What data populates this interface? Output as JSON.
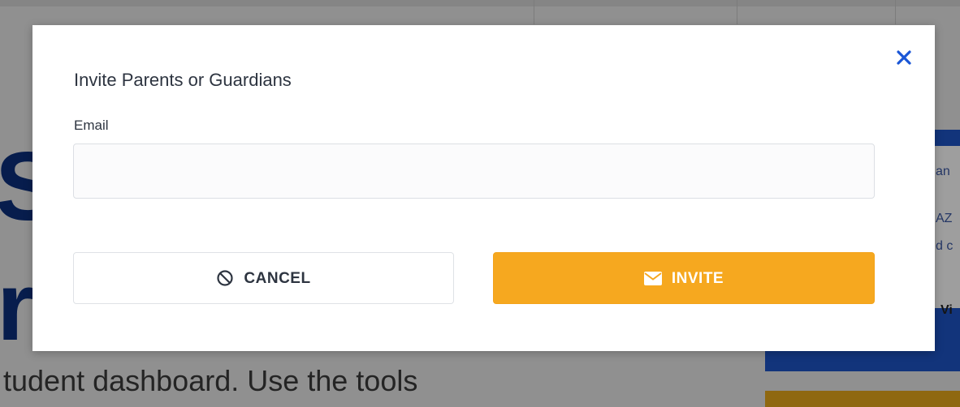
{
  "background": {
    "big_letter_1": "S",
    "big_letter_2": "r",
    "text_line": "tudent dashboard. Use the tools",
    "side_snip_1": "an",
    "side_snip_2": "AZ",
    "side_snip_3": "d c",
    "side_snip_4": "Vi"
  },
  "modal": {
    "title": "Invite Parents or Guardians",
    "email_label": "Email",
    "email_value": "",
    "email_placeholder": "",
    "close_icon": "close-icon",
    "cancel_label": "CANCEL",
    "cancel_icon": "ban-icon",
    "invite_label": "INVITE",
    "invite_icon": "envelope-icon"
  },
  "colors": {
    "invite_button": "#f6a81f",
    "close_icon": "#1a56d6",
    "text": "#2d3440"
  }
}
